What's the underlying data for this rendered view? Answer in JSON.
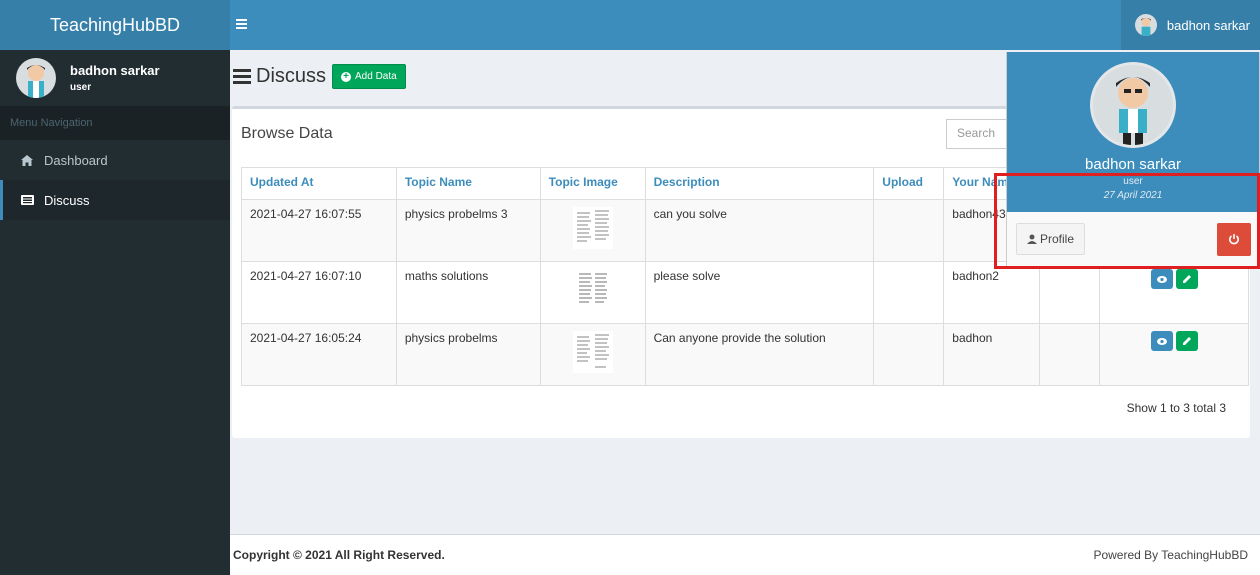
{
  "app": {
    "brand": "TeachingHubBD"
  },
  "sidebar": {
    "user_name": "badhon sarkar",
    "user_role": "user",
    "menu_header": "Menu Navigation",
    "items": [
      {
        "label": "Dashboard",
        "icon": "home-icon",
        "active": false
      },
      {
        "label": "Discuss",
        "icon": "list-alt-icon",
        "active": true
      }
    ]
  },
  "topbar": {
    "user_name": "badhon sarkar"
  },
  "page": {
    "title": "Discuss",
    "add_button": "Add Data"
  },
  "box": {
    "title": "Browse Data",
    "search_placeholder": "Search",
    "columns": [
      "Updated At",
      "Topic Name",
      "Topic Image",
      "Description",
      "Upload",
      "Your Name",
      "",
      ""
    ],
    "rows": [
      {
        "updated_at": "2021-04-27 16:07:55",
        "topic": "physics probelms 3",
        "description": "can you solve",
        "upload": "",
        "your_name": "badhon43"
      },
      {
        "updated_at": "2021-04-27 16:07:10",
        "topic": "maths solutions",
        "description": "please solve",
        "upload": "",
        "your_name": "badhon2"
      },
      {
        "updated_at": "2021-04-27 16:05:24",
        "topic": "physics probelms",
        "description": "Can anyone provide the solution",
        "upload": "",
        "your_name": "badhon"
      }
    ],
    "info": "Show 1 to 3 total 3"
  },
  "footer": {
    "copyright": "Copyright © 2021 All Right Reserved.",
    "powered": "Powered By TeachingHubBD"
  },
  "dropdown": {
    "name": "badhon sarkar",
    "role": "user",
    "date": "27 April 2021",
    "profile_button": "Profile"
  },
  "colors": {
    "primary": "#3c8dbc",
    "sidebar": "#222d32",
    "success": "#00a65a",
    "danger": "#dd4b39",
    "highlight": "#e02020"
  }
}
